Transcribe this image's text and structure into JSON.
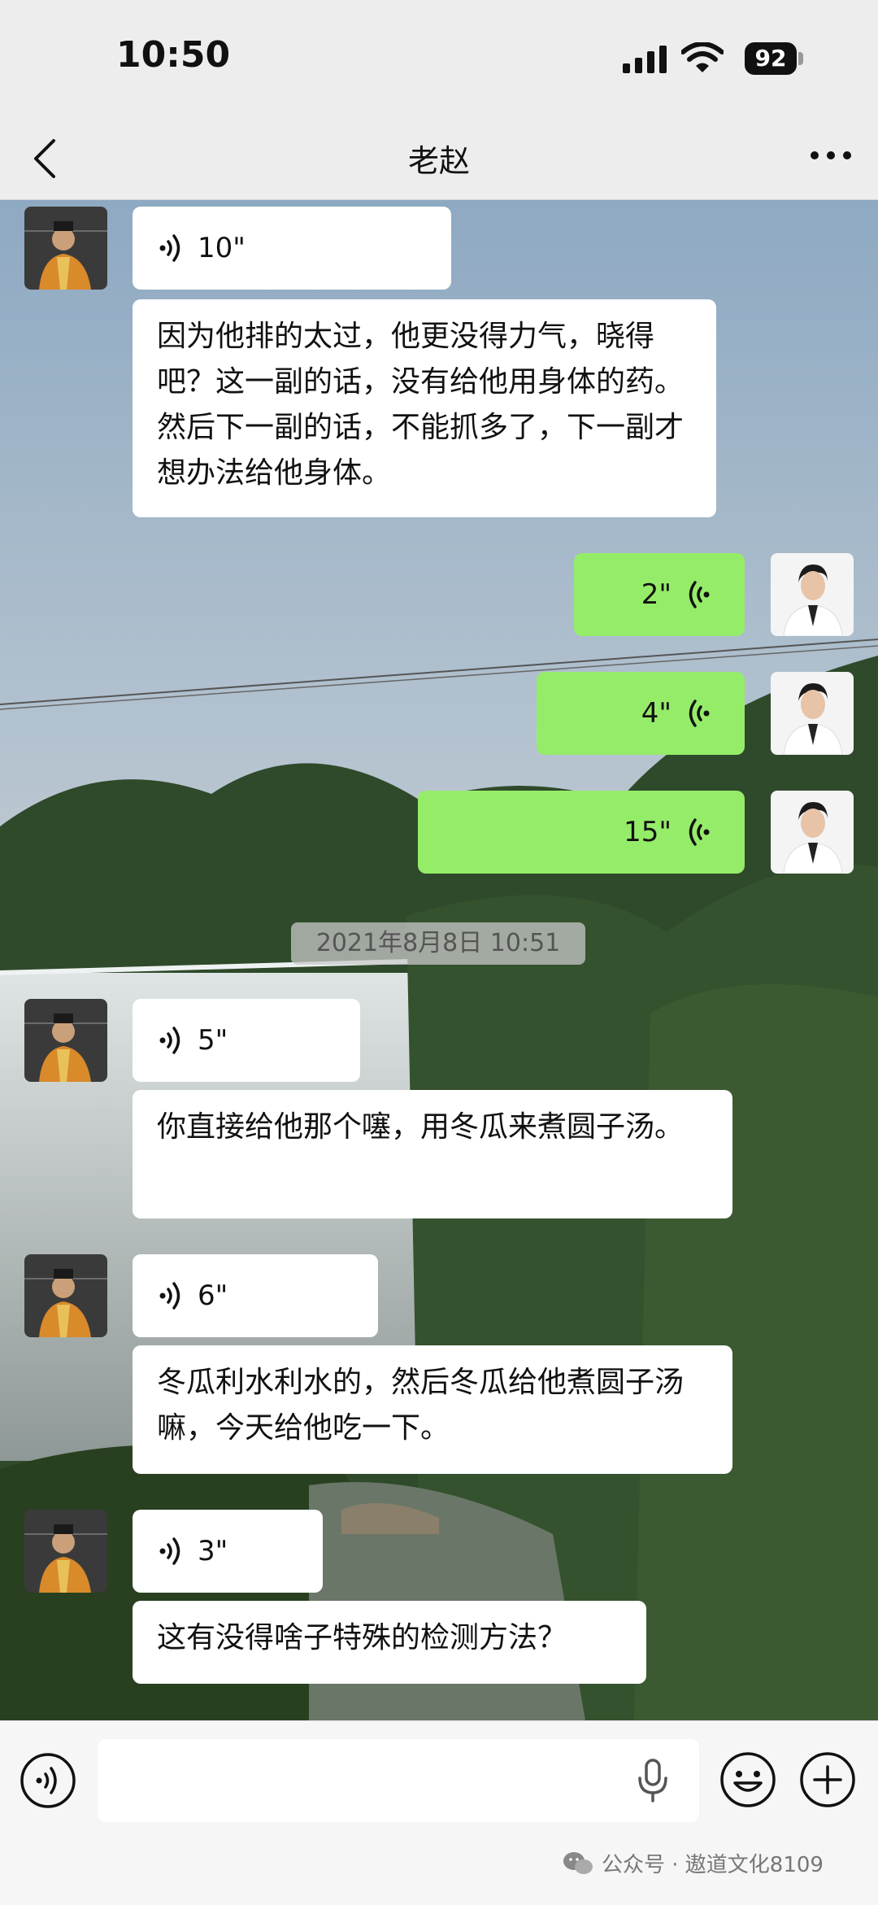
{
  "status_bar": {
    "time": "10:50",
    "battery": "92"
  },
  "nav": {
    "title": "老赵",
    "back_icon": "chevron-left-icon",
    "more_icon": "more-dots-icon"
  },
  "messages": [
    {
      "side": "left",
      "kind": "voice",
      "duration": "10\""
    },
    {
      "side": "left",
      "kind": "text",
      "text": "因为他排的太过，他更没得力气，晓得吧？这一副的话，没有给他用身体的药。然后下一副的话，不能抓多了，下一副才想办法给他身体。"
    },
    {
      "side": "right",
      "kind": "voice",
      "duration": "2\""
    },
    {
      "side": "right",
      "kind": "voice",
      "duration": "4\""
    },
    {
      "side": "right",
      "kind": "voice",
      "duration": "15\""
    },
    {
      "side": "left",
      "kind": "voice",
      "duration": "5\""
    },
    {
      "side": "left",
      "kind": "text",
      "text": "你直接给他那个噻，用冬瓜来煮圆子汤。"
    },
    {
      "side": "left",
      "kind": "voice",
      "duration": "6\""
    },
    {
      "side": "left",
      "kind": "text",
      "text": "冬瓜利水利水的，然后冬瓜给他煮圆子汤嘛，今天给他吃一下。"
    },
    {
      "side": "left",
      "kind": "voice",
      "duration": "3\""
    },
    {
      "side": "left",
      "kind": "text",
      "text": "这有没得啥子特殊的检测方法？"
    }
  ],
  "timestamp": "2021年8月8日 10:51",
  "input_bar": {
    "voice_icon": "voice-mode-icon",
    "mic_icon": "microphone-icon",
    "emoji_icon": "emoji-icon",
    "plus_icon": "plus-icon"
  },
  "watermark": "公众号 · 遨道文化8109",
  "colors": {
    "self_bubble": "#95ec69",
    "other_bubble": "#ffffff",
    "background": "#ededed"
  }
}
